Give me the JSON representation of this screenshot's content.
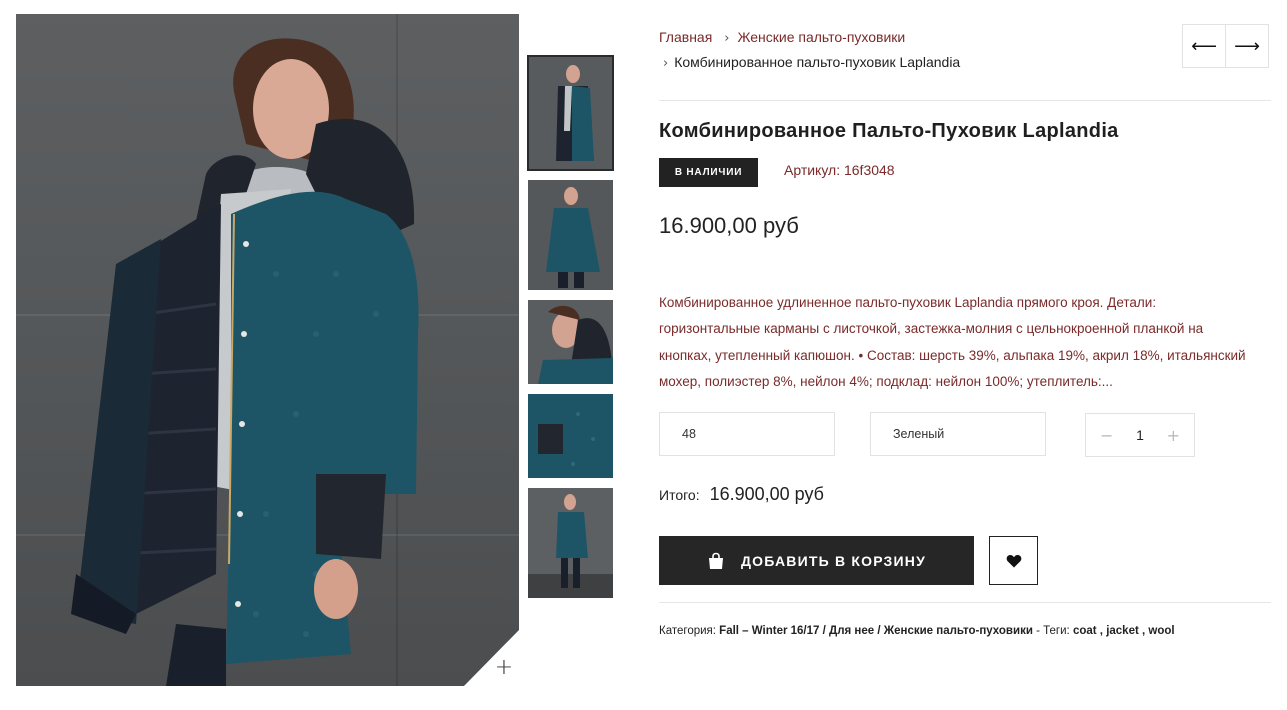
{
  "breadcrumb": {
    "home": "Главная",
    "category": "Женские пальто-пуховики",
    "current": "Комбинированное пальто-пуховик Laplandia"
  },
  "nav": {
    "prev_icon": "arrow-left-icon",
    "next_icon": "arrow-right-icon",
    "prev": "⟵",
    "next": "⟶"
  },
  "product": {
    "title": "Комбинированное Пальто-Пуховик Laplandia",
    "stock": "В НАЛИЧИИ",
    "sku_label": "Артикул:",
    "sku": "16f3048",
    "price": "16.900,00 руб",
    "description": "Комбинированное удлиненное пальто-пуховик Laplandia прямого кроя. Детали: горизонтальные карманы с листочкой, застежка-молния с цельнокроенной планкой на кнопках, утепленный капюшон. • Состав: шерсть 39%, альпака 19%, акрил 18%, итальянский мохер, полиэстер 8%, нейлон 4%; подклад: нейлон 100%; утеплитель:..."
  },
  "options": {
    "size": "48",
    "color": "Зеленый",
    "quantity": "1",
    "minus": "−",
    "plus": "+"
  },
  "total": {
    "label": "Итого:",
    "value": "16.900,00 руб"
  },
  "actions": {
    "add_to_cart": "ДОБАВИТЬ В КОРЗИНУ",
    "cart_icon": "shopping-bag-icon",
    "wishlist_icon": "heart-icon"
  },
  "meta": {
    "category_label": "Категория:",
    "category_path": "Fall – Winter 16/17 / Для нее / Женские пальто-пуховики",
    "tags_label": "- Теги:",
    "tags": [
      "coat",
      "jacket",
      "wool"
    ]
  },
  "gallery": {
    "zoom_icon": "plus-zoom-icon",
    "zoom": "+"
  },
  "colors": {
    "accent": "#7a2a2a",
    "dark": "#262626",
    "coat": "#1e5566"
  }
}
